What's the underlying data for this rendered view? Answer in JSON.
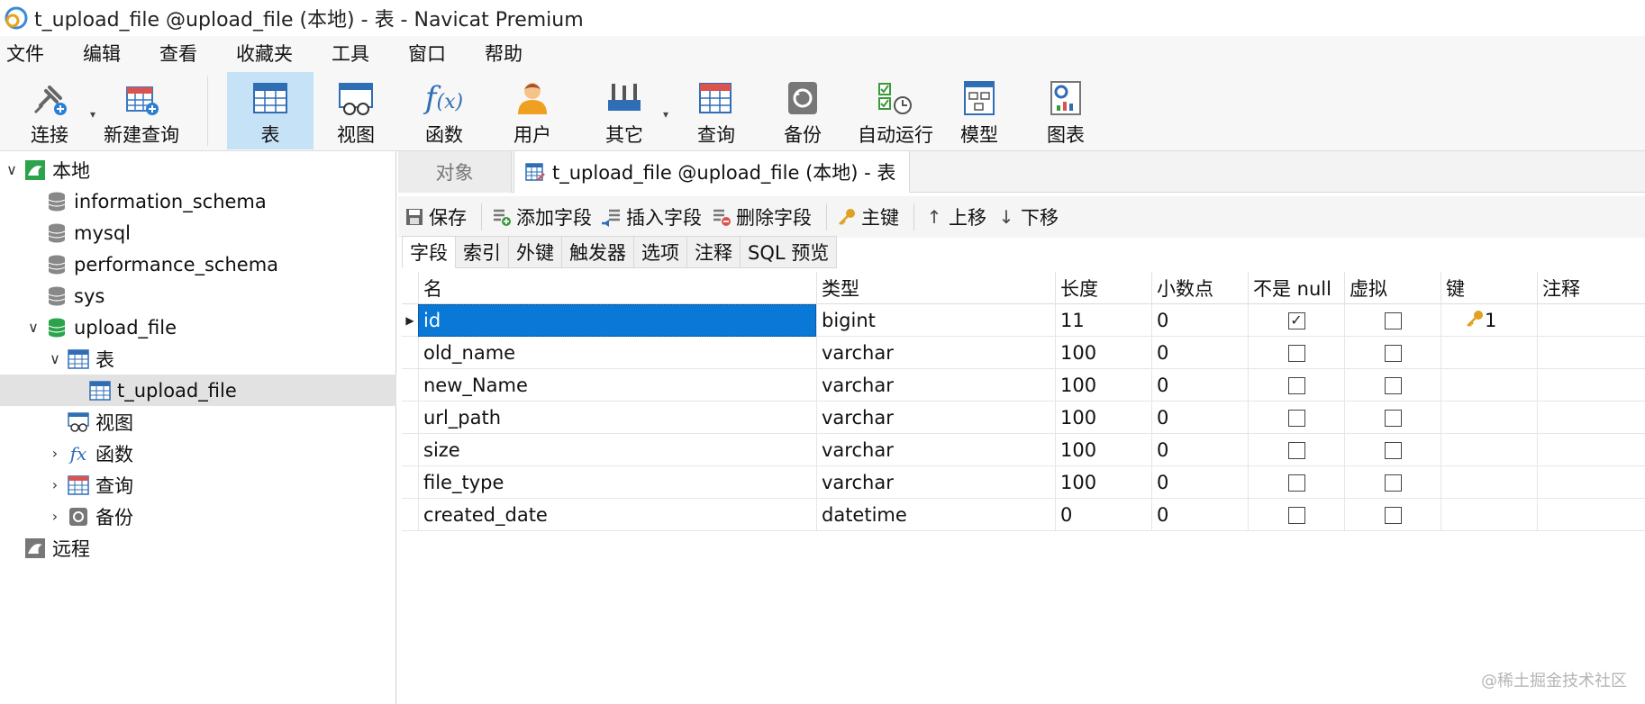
{
  "window": {
    "title": "t_upload_file @upload_file (本地) - 表 - Navicat Premium"
  },
  "menu": [
    "文件",
    "编辑",
    "查看",
    "收藏夹",
    "工具",
    "窗口",
    "帮助"
  ],
  "toolbar": {
    "connect": "连接",
    "new_query": "新建查询",
    "table": "表",
    "view": "视图",
    "function": "函数",
    "user": "用户",
    "others": "其它",
    "query": "查询",
    "backup": "备份",
    "automation": "自动运行",
    "model": "模型",
    "chart": "图表",
    "active": "表"
  },
  "sidebar": {
    "local": "本地",
    "databases": [
      "information_schema",
      "mysql",
      "performance_schema",
      "sys"
    ],
    "upload_db": "upload_file",
    "tables_folder": "表",
    "table_item": "t_upload_file",
    "views_folder": "视图",
    "functions_folder": "函数",
    "queries_folder": "查询",
    "backups_folder": "备份",
    "remote": "远程"
  },
  "tabs": {
    "objects": "对象",
    "current": "t_upload_file @upload_file (本地) - 表"
  },
  "actions": {
    "save": "保存",
    "add_field": "添加字段",
    "insert_field": "插入字段",
    "delete_field": "删除字段",
    "primary_key": "主键",
    "move_up": "上移",
    "move_down": "下移"
  },
  "subtabs": [
    "字段",
    "索引",
    "外键",
    "触发器",
    "选项",
    "注释",
    "SQL 预览"
  ],
  "grid": {
    "headers": {
      "name": "名",
      "type": "类型",
      "length": "长度",
      "decimals": "小数点",
      "not_null": "不是 null",
      "virtual": "虚拟",
      "key": "键",
      "comment": "注释"
    },
    "rows": [
      {
        "name": "id",
        "type": "bigint",
        "length": "11",
        "decimals": "0",
        "not_null": true,
        "virtual": false,
        "key": "1"
      },
      {
        "name": "old_name",
        "type": "varchar",
        "length": "100",
        "decimals": "0",
        "not_null": false,
        "virtual": false,
        "key": ""
      },
      {
        "name": "new_Name",
        "type": "varchar",
        "length": "100",
        "decimals": "0",
        "not_null": false,
        "virtual": false,
        "key": ""
      },
      {
        "name": "url_path",
        "type": "varchar",
        "length": "100",
        "decimals": "0",
        "not_null": false,
        "virtual": false,
        "key": ""
      },
      {
        "name": "size",
        "type": "varchar",
        "length": "100",
        "decimals": "0",
        "not_null": false,
        "virtual": false,
        "key": ""
      },
      {
        "name": "file_type",
        "type": "varchar",
        "length": "100",
        "decimals": "0",
        "not_null": false,
        "virtual": false,
        "key": ""
      },
      {
        "name": "created_date",
        "type": "datetime",
        "length": "0",
        "decimals": "0",
        "not_null": false,
        "virtual": false,
        "key": ""
      }
    ]
  },
  "watermark": "@稀土掘金技术社区",
  "colors": {
    "selection": "#0a78d7",
    "active_tool": "#c6e2f7"
  }
}
